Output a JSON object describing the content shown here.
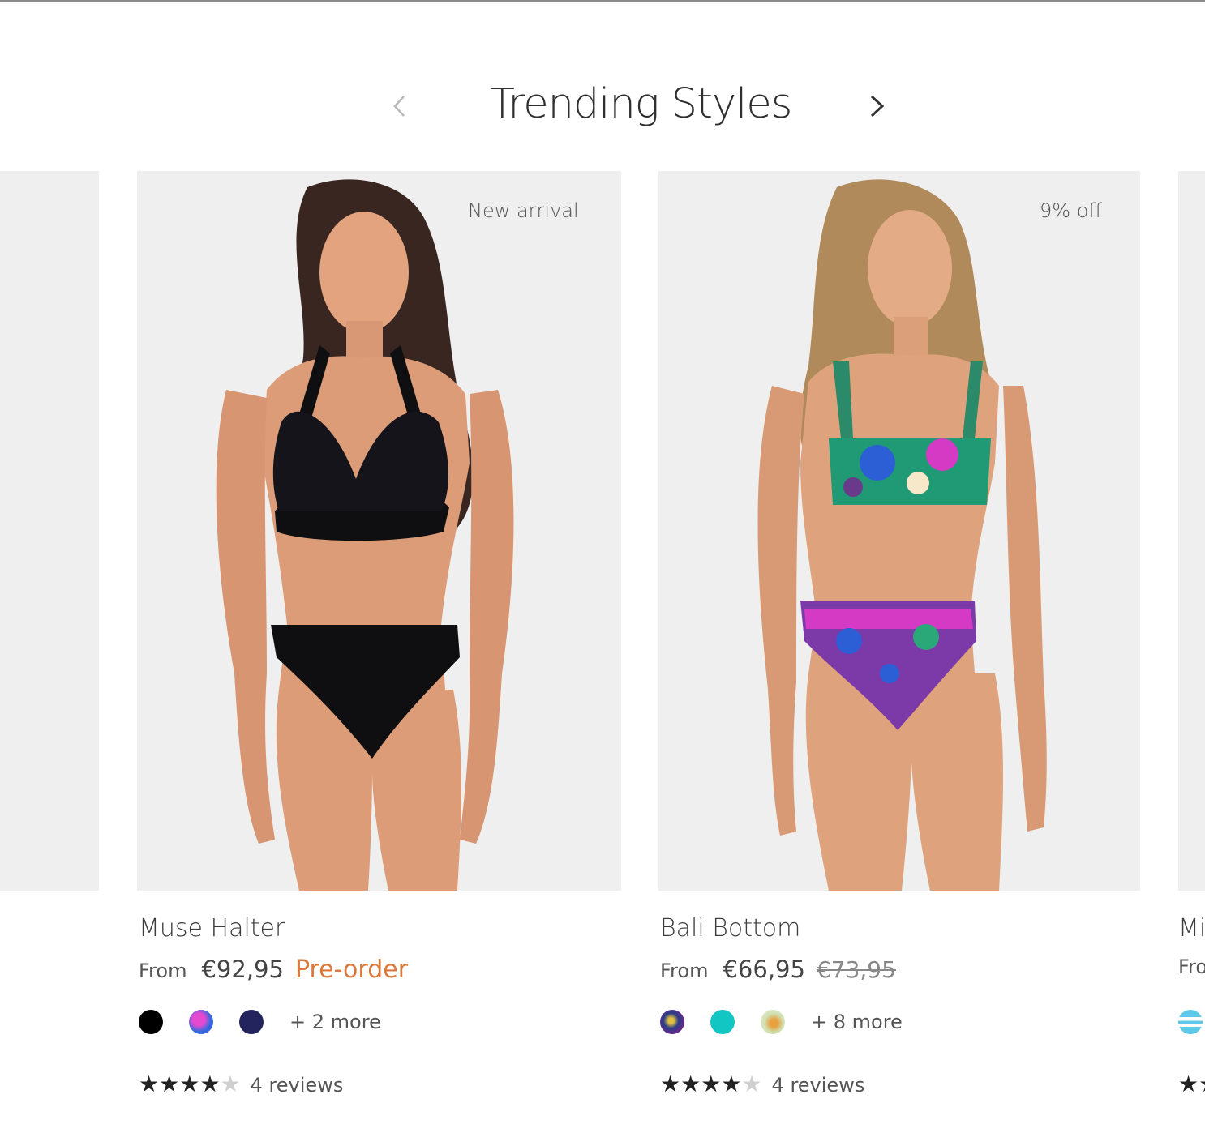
{
  "section": {
    "title": "Trending Styles"
  },
  "icons": {
    "prev": "chevron-left-icon",
    "next": "chevron-right-icon",
    "star": "star-icon"
  },
  "products": [
    {
      "badge": "New arrival",
      "name": "Muse Halter",
      "from_label": "From",
      "price": "€92,95",
      "preorder": "Pre-order",
      "swatch_colors": [
        "#000000",
        "#5a44d8",
        "#23235e"
      ],
      "more_colors": "+ 2 more",
      "rating": 4,
      "rating_max": 5,
      "reviews": "4 reviews"
    },
    {
      "badge": "9% off",
      "name": "Bali Bottom",
      "from_label": "From",
      "price": "€66,95",
      "old_price": "€73,95",
      "swatch_colors": [
        "#2a3c88",
        "#12c6c3",
        "#e2e2c8"
      ],
      "more_colors": "+ 8 more",
      "rating": 4,
      "rating_max": 5,
      "reviews": "4 reviews"
    },
    {
      "name": "Mi",
      "from_label": "Fro",
      "swatch_colors": [
        "#5ec8e8"
      ]
    }
  ]
}
